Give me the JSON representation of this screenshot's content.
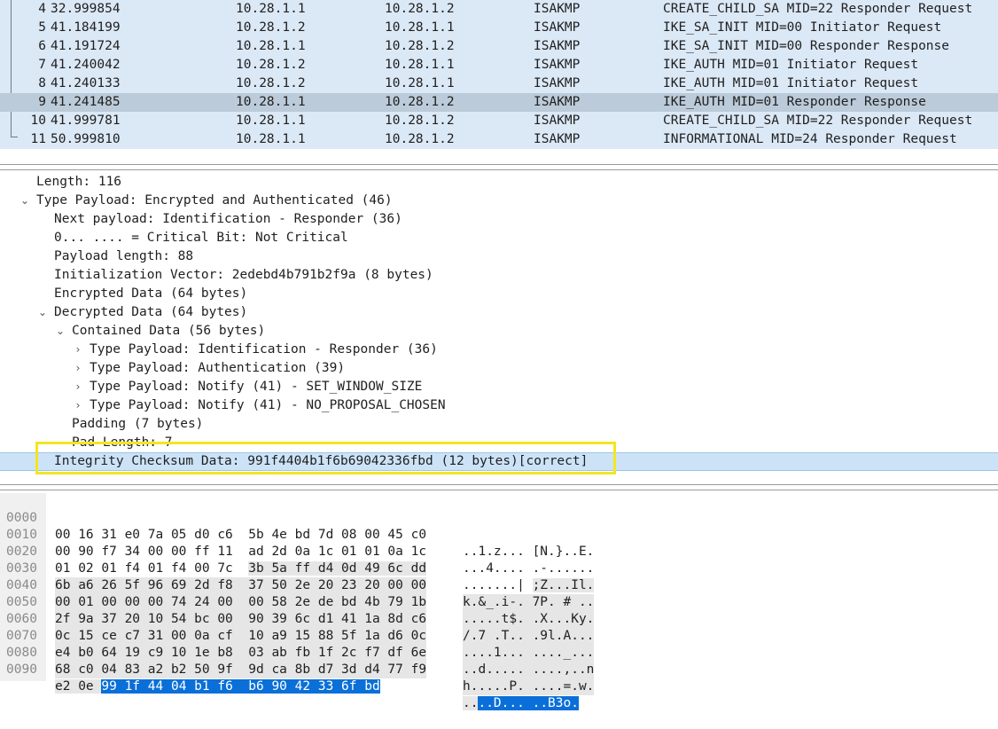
{
  "packet_list": {
    "rows": [
      {
        "no": "4",
        "time": "32.999854",
        "src": "10.28.1.1",
        "dst": "10.28.1.2",
        "proto": "ISAKMP",
        "info": "CREATE_CHILD_SA MID=22 Responder Request"
      },
      {
        "no": "5",
        "time": "41.184199",
        "src": "10.28.1.2",
        "dst": "10.28.1.1",
        "proto": "ISAKMP",
        "info": "IKE_SA_INIT MID=00 Initiator Request"
      },
      {
        "no": "6",
        "time": "41.191724",
        "src": "10.28.1.1",
        "dst": "10.28.1.2",
        "proto": "ISAKMP",
        "info": "IKE_SA_INIT MID=00 Responder Response"
      },
      {
        "no": "7",
        "time": "41.240042",
        "src": "10.28.1.2",
        "dst": "10.28.1.1",
        "proto": "ISAKMP",
        "info": "IKE_AUTH MID=01 Initiator Request"
      },
      {
        "no": "8",
        "time": "41.240133",
        "src": "10.28.1.2",
        "dst": "10.28.1.1",
        "proto": "ISAKMP",
        "info": "IKE_AUTH MID=01 Initiator Request"
      },
      {
        "no": "9",
        "time": "41.241485",
        "src": "10.28.1.1",
        "dst": "10.28.1.2",
        "proto": "ISAKMP",
        "info": "IKE_AUTH MID=01 Responder Response"
      },
      {
        "no": "10",
        "time": "41.999781",
        "src": "10.28.1.1",
        "dst": "10.28.1.2",
        "proto": "ISAKMP",
        "info": "CREATE_CHILD_SA MID=22 Responder Request"
      },
      {
        "no": "11",
        "time": "50.999810",
        "src": "10.28.1.1",
        "dst": "10.28.1.2",
        "proto": "ISAKMP",
        "info": "INFORMATIONAL MID=24 Responder Request"
      }
    ]
  },
  "details": {
    "length": "Length: 116",
    "type_payload": "Type Payload: Encrypted and Authenticated (46)",
    "next_payload": "Next payload: Identification - Responder (36)",
    "critical_bit": "0... .... = Critical Bit: Not Critical",
    "payload_length": "Payload length: 88",
    "iv": "Initialization Vector: 2edebd4b791b2f9a (8 bytes)",
    "encrypted_data": "Encrypted Data (64 bytes)",
    "decrypted_data": "Decrypted Data (64 bytes)",
    "contained_data": "Contained Data (56 bytes)",
    "tp_identification": "Type Payload: Identification - Responder (36)",
    "tp_authentication": "Type Payload: Authentication (39)",
    "tp_notify_window": "Type Payload: Notify (41) - SET_WINDOW_SIZE",
    "tp_notify_noproposal": "Type Payload: Notify (41) - NO_PROPOSAL_CHOSEN",
    "padding": "Padding (7 bytes)",
    "pad_length": "Pad Length: 7",
    "integrity": "Integrity Checksum Data: 991f4404b1f6b69042336fbd (12 bytes)[correct]"
  },
  "hex": {
    "rows": [
      {
        "off": "0000",
        "b1": "00 16 31 e0 7a 05 d0 c6",
        "b2": "5b 4e bd 7d 08 00 45 c0",
        "a1": "..1.z...",
        "a2": "[N.}..E."
      },
      {
        "off": "0010",
        "b1": "00 90 f7 34 00 00 ff 11",
        "b2": "ad 2d 0a 1c 01 01 0a 1c",
        "a1": "...4....",
        "a2": ".-......"
      },
      {
        "off": "0020",
        "b1": "01 02 01 f4 01 f4 00 7c",
        "b2": "3b 5a ff d4 0d 49 6c dd",
        "a1": ".......|",
        "a2": ";Z...Il."
      },
      {
        "off": "0030",
        "b1": "6b a6 26 5f 96 69 2d f8",
        "b2": "37 50 2e 20 23 20 00 00",
        "a1": "k.&_.i-.",
        "a2": "7P. # .."
      },
      {
        "off": "0040",
        "b1": "00 01 00 00 00 74 24 00",
        "b2": "00 58 2e de bd 4b 79 1b",
        "a1": ".....t$.",
        "a2": ".X...Ky."
      },
      {
        "off": "0050",
        "b1": "2f 9a 37 20 10 54 bc 00",
        "b2": "90 39 6c d1 41 1a 8d c6",
        "a1": "/.7 .T..",
        "a2": ".9l.A..."
      },
      {
        "off": "0060",
        "b1": "0c 15 ce c7 31 00 0a cf",
        "b2": "10 a9 15 88 5f 1a d6 0c",
        "a1": "....1...",
        "a2": "...._..."
      },
      {
        "off": "0070",
        "b1": "e4 b0 64 19 c9 10 1e b8",
        "b2": "03 ab fb 1f 2c f7 df 6e",
        "a1": "..d.....",
        "a2": "....,..n"
      },
      {
        "off": "0080",
        "b1": "68 c0 04 83 a2 b2 50 9f",
        "b2": "9d ca 8b d7 3d d4 77 f9",
        "a1": "h.....P.",
        "a2": "....=.w."
      }
    ],
    "last": {
      "off": "0090",
      "b1_plain": "e2 0e ",
      "b1_sel": "99 1f 44 04 b1 f6",
      "b2_sel": "b6 90 42 33 6f bd",
      "a1_plain": "..",
      "a1_sel": "..D...",
      "a2_sel": "..B3o."
    }
  }
}
